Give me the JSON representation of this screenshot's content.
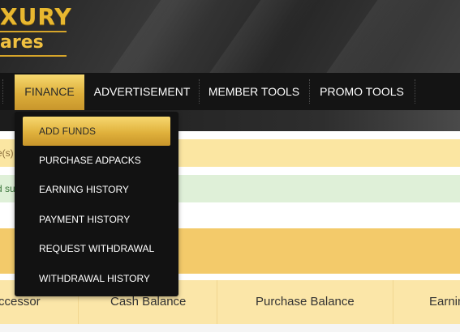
{
  "logo": {
    "title": "XURY",
    "subtitle": "ares"
  },
  "nav": {
    "items": [
      "FINANCE",
      "ADVERTISEMENT",
      "MEMBER TOOLS",
      "PROMO TOOLS"
    ],
    "active": "FINANCE"
  },
  "dropdown": {
    "items": [
      "ADD FUNDS",
      "PURCHASE ADPACKS",
      "EARNING HISTORY",
      "PAYMENT HISTORY",
      "REQUEST WITHDRAWAL",
      "WITHDRAWAL HISTORY"
    ],
    "active": "ADD FUNDS"
  },
  "alerts": {
    "warning_text": "e(s)",
    "success_text": "d su"
  },
  "table": {
    "columns": [
      "ccessor",
      "Cash Balance",
      "Purchase Balance",
      "Earnin"
    ]
  },
  "colors": {
    "accent_gold": "#e0b13c",
    "nav_bg": "#141414",
    "warning_bg": "#fbe6a2",
    "success_bg": "#dff0d8",
    "table_head_bg": "#fbe6a8"
  }
}
